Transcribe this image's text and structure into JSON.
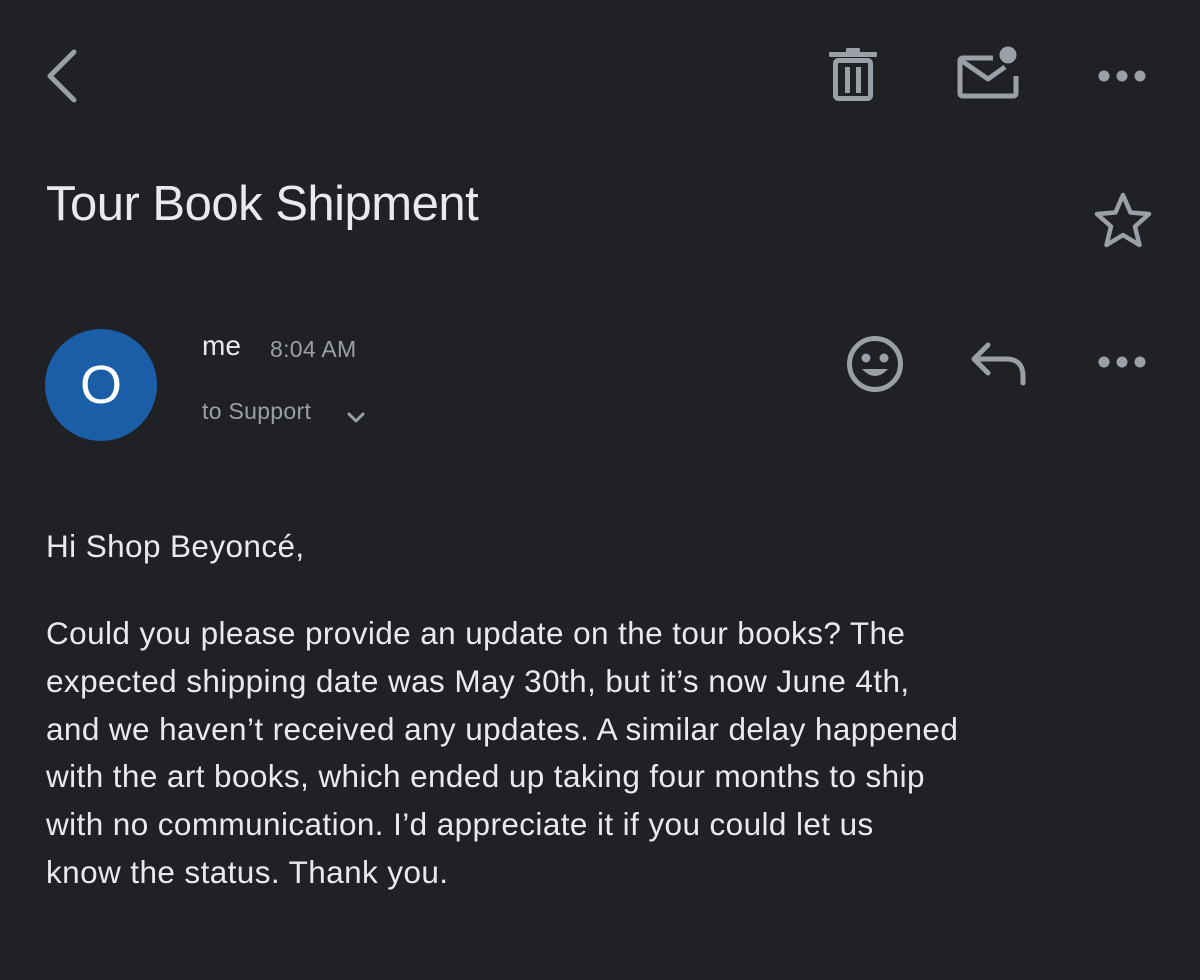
{
  "toolbar": {
    "back_icon": "chevron-left-icon",
    "delete_icon": "trash-icon",
    "mark_unread_icon": "mail-unread-icon",
    "more_icon": "more-horizontal-icon"
  },
  "email": {
    "subject": "Tour Book Shipment",
    "star_icon": "star-outline-icon",
    "sender": {
      "avatar_letter": "O",
      "avatar_color": "#1a5ea8",
      "name": "me",
      "time": "8:04 AM",
      "recipients": "to Support"
    },
    "actions": {
      "emoji_icon": "emoji-reaction-icon",
      "reply_icon": "reply-icon",
      "more_icon": "more-horizontal-icon"
    },
    "greeting": "Hi Shop Beyoncé,",
    "body_lines": [
      "Could you please provide an update on the tour books? The",
      "expected shipping date was May 30th, but it’s now June 4th,",
      "and we haven’t received any updates. A similar delay happened",
      "with the art books, which ended up taking four months to ship",
      "with no communication. I’d appreciate it if you could let us",
      "know the status. Thank you."
    ]
  },
  "colors": {
    "background": "#202124",
    "text_primary": "#e8eaed",
    "text_secondary": "#9aa0a6",
    "icon": "#9aa0a6"
  }
}
